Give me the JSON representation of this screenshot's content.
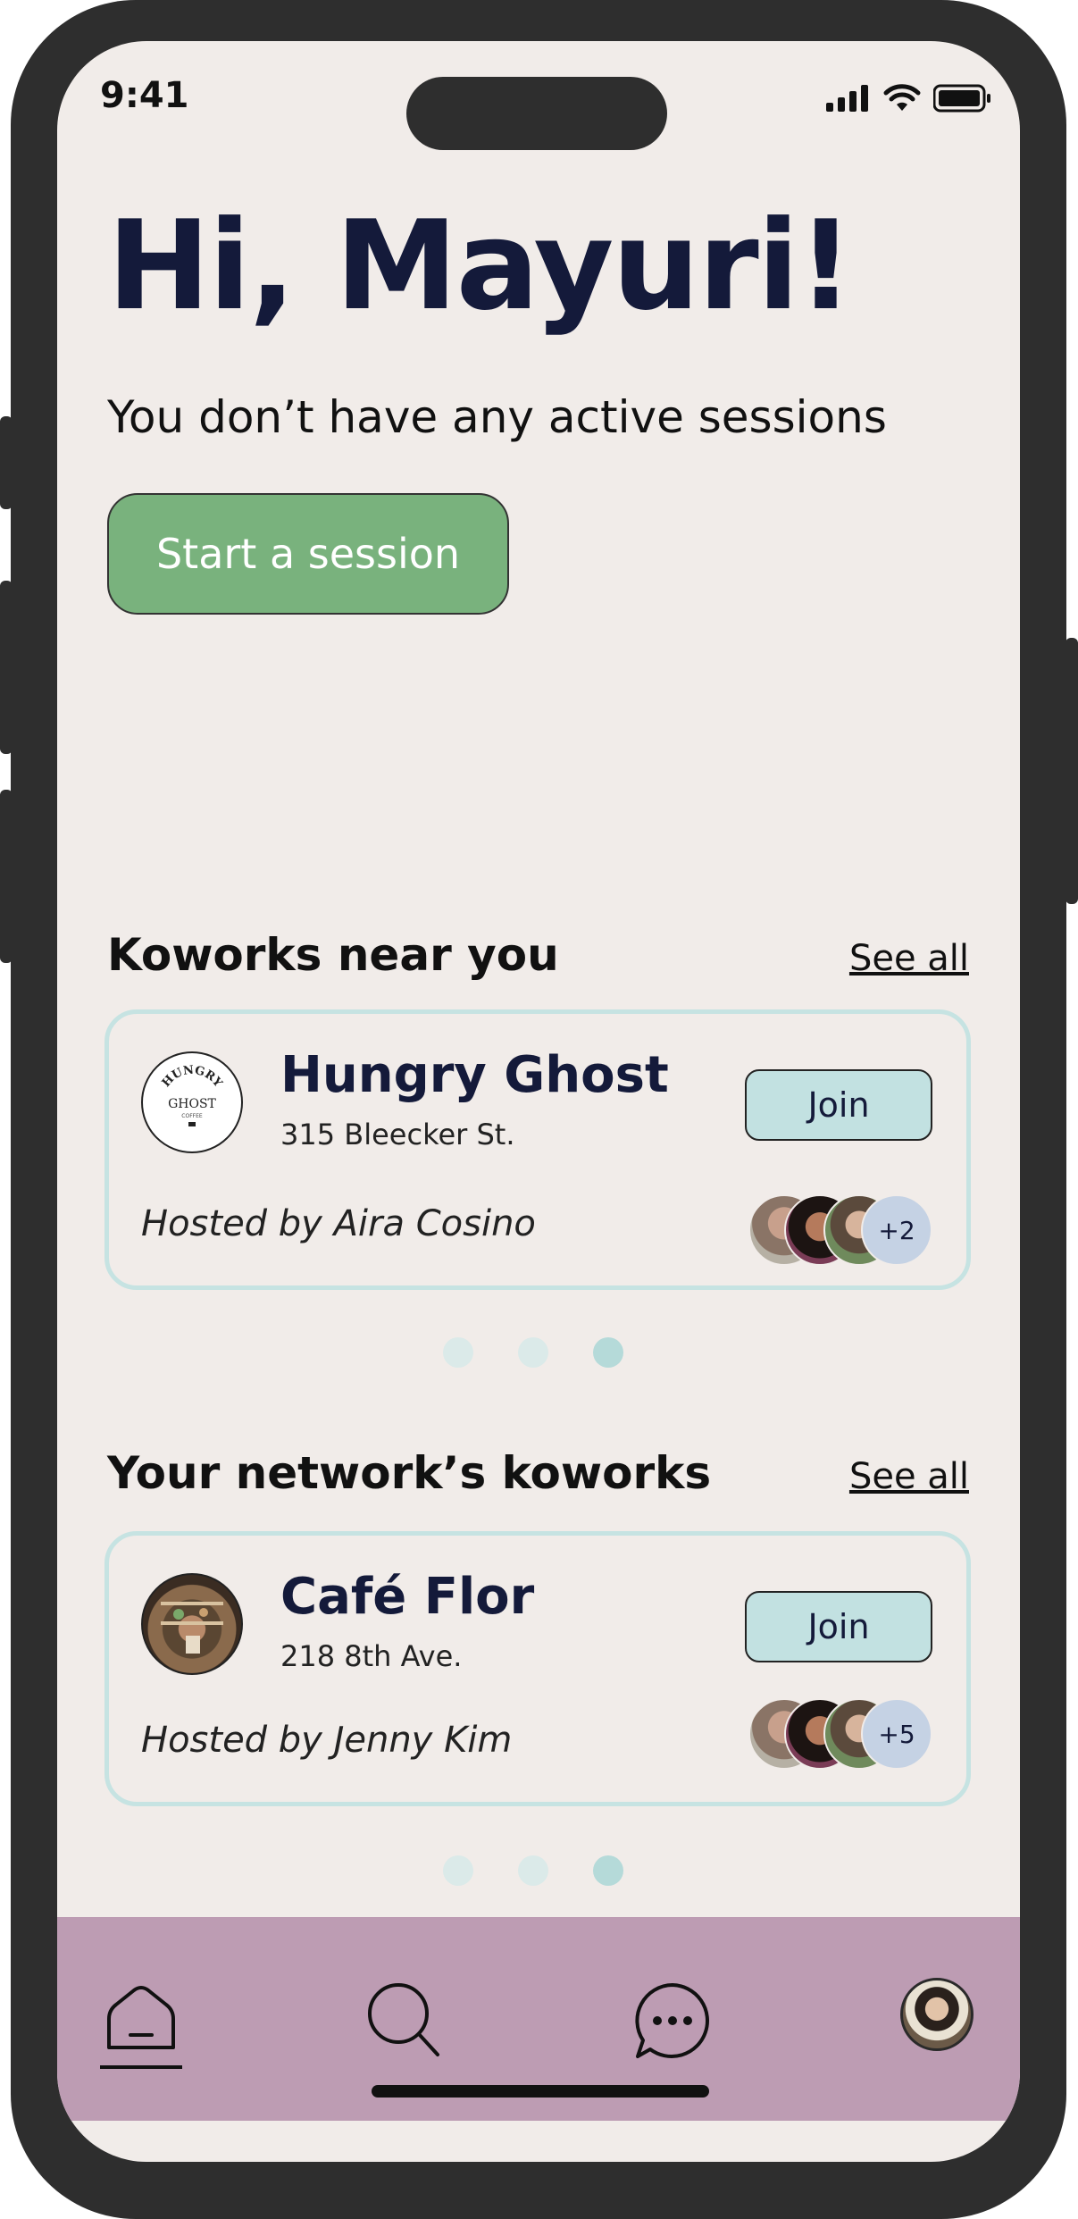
{
  "status_bar": {
    "time": "9:41"
  },
  "header": {
    "greeting": "Hi, Mayuri!",
    "subtitle": "You don’t have any active sessions",
    "start_button": "Start a session"
  },
  "nearby": {
    "section_title": "Koworks near you",
    "see_all": "See all",
    "card": {
      "name": "Hungry Ghost",
      "address": "315 Bleecker St.",
      "join_label": "Join",
      "hosted_by": "Hosted by Aira Cosino",
      "extra_count": "+2",
      "logo_text": "HUNGRY GHOST"
    },
    "pagination": {
      "total": 3,
      "active": 3
    }
  },
  "network": {
    "section_title": "Your network’s koworks",
    "see_all": "See all",
    "card": {
      "name": "Café Flor",
      "address": "218 8th Ave.",
      "join_label": "Join",
      "hosted_by": "Hosted by Jenny Kim",
      "extra_count": "+5"
    },
    "pagination": {
      "total": 3,
      "active": 3
    }
  },
  "tab_bar": {
    "items": [
      {
        "icon": "home-icon",
        "active": true
      },
      {
        "icon": "search-icon",
        "active": false
      },
      {
        "icon": "chat-icon",
        "active": false
      },
      {
        "icon": "profile-avatar",
        "active": false
      }
    ]
  },
  "colors": {
    "primary_button": "#79b27d",
    "join_button": "#c2e1e1",
    "tab_bar": "#bd9cb3",
    "background": "#f1ece9",
    "heading": "#141a3a"
  }
}
